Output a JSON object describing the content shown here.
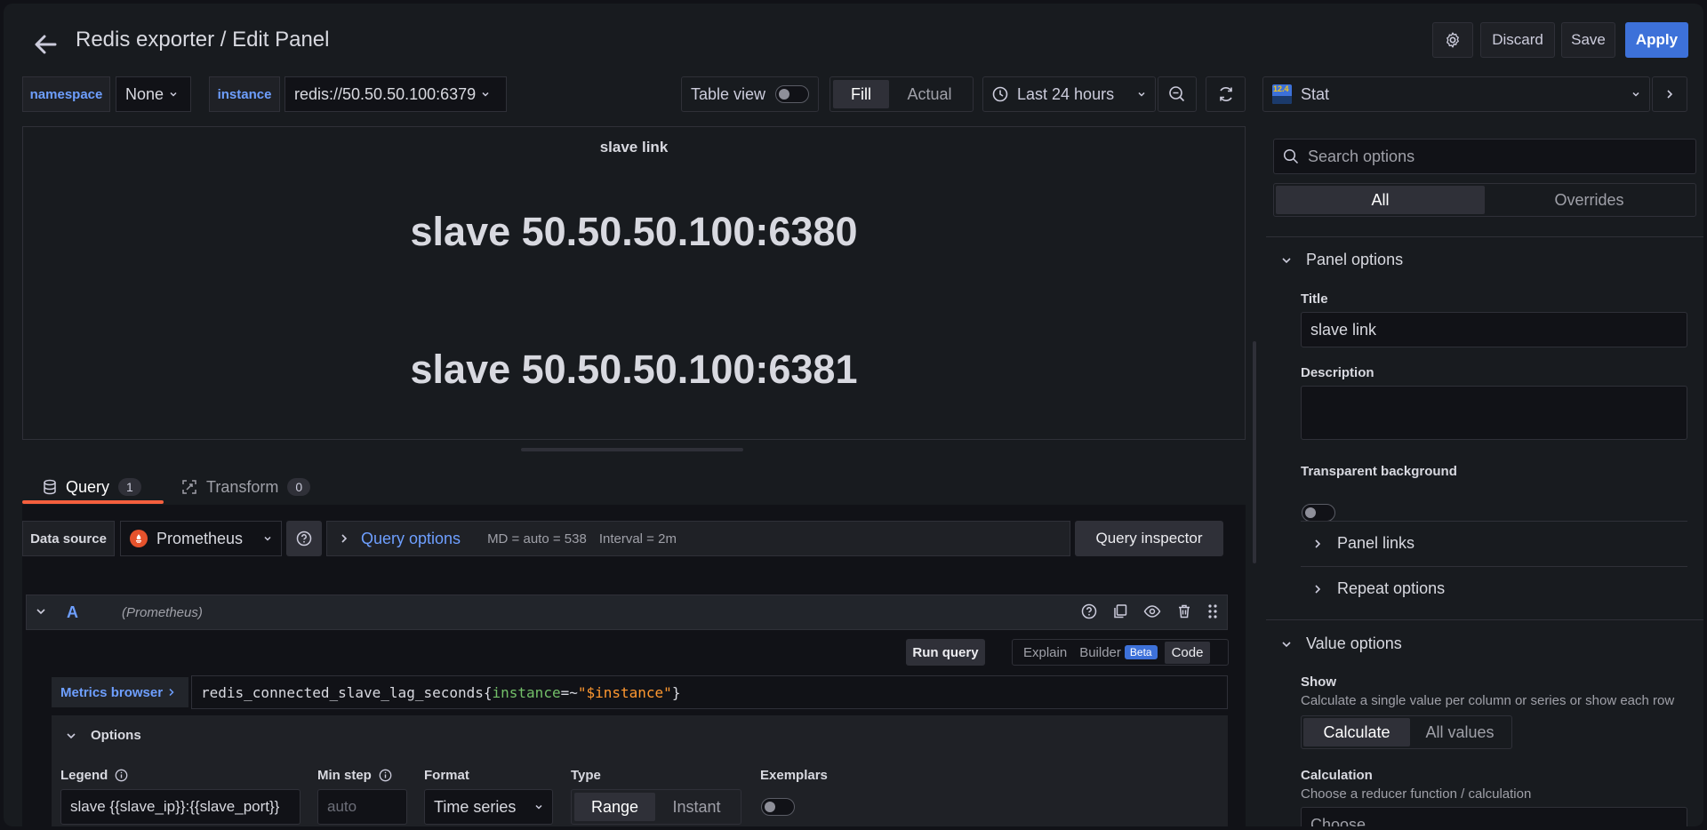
{
  "header": {
    "title": "Redis exporter / Edit Panel",
    "discard_label": "Discard",
    "save_label": "Save",
    "apply_label": "Apply"
  },
  "variables": [
    {
      "label": "namespace",
      "value": "None"
    },
    {
      "label": "instance",
      "value": "redis://50.50.50.100:6379"
    }
  ],
  "toolbar": {
    "table_view_label": "Table view",
    "fill_label": "Fill",
    "actual_label": "Actual",
    "time_range": "Last 24 hours"
  },
  "viz_picker": {
    "icon_text": "12.4",
    "label": "Stat"
  },
  "preview": {
    "title": "slave link",
    "values": [
      "slave 50.50.50.100:6380",
      "slave 50.50.50.100:6381"
    ]
  },
  "query_tabs": [
    {
      "label": "Query",
      "count": "1"
    },
    {
      "label": "Transform",
      "count": "0"
    }
  ],
  "datasource": {
    "label": "Data source",
    "name": "Prometheus",
    "query_options_label": "Query options",
    "md": "MD = auto = 538",
    "interval": "Interval = 2m",
    "inspector_label": "Query inspector"
  },
  "query": {
    "ref_id": "A",
    "source": "(Prometheus)",
    "run_label": "Run query",
    "explain_label": "Explain",
    "builder_label": "Builder",
    "beta_label": "Beta",
    "code_label": "Code",
    "metrics_browser_label": "Metrics browser",
    "expr_metric": "redis_connected_slave_lag_seconds{",
    "expr_key": "instance",
    "expr_op": "=~",
    "expr_val": "\"$instance\"",
    "expr_close": "}"
  },
  "options": {
    "title": "Options",
    "legend_label": "Legend",
    "legend_value": "slave {{slave_ip}}:{{slave_port}}",
    "minstep_label": "Min step",
    "minstep_placeholder": "auto",
    "format_label": "Format",
    "format_value": "Time series",
    "type_label": "Type",
    "range_label": "Range",
    "instant_label": "Instant",
    "exemplars_label": "Exemplars"
  },
  "side": {
    "search_placeholder": "Search options",
    "tab_all": "All",
    "tab_overrides": "Overrides",
    "panel_options": "Panel options",
    "title_label": "Title",
    "title_value": "slave link",
    "description_label": "Description",
    "transparent_label": "Transparent background",
    "panel_links": "Panel links",
    "repeat_options": "Repeat options",
    "value_options": "Value options",
    "show_label": "Show",
    "show_desc": "Calculate a single value per column or series or show each row",
    "calculate_label": "Calculate",
    "all_values_label": "All values",
    "calculation_label": "Calculation",
    "calculation_desc": "Choose a reducer function / calculation",
    "choose_placeholder": "Choose"
  },
  "colors": {
    "accent": "#3d71d9",
    "link": "#6e9fff",
    "tab_underline": "#f55f3e",
    "prometheus": "#e6522c"
  }
}
